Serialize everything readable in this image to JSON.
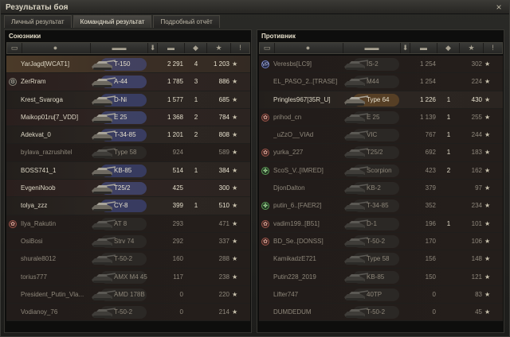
{
  "window": {
    "title": "Результаты боя",
    "close_label": "×"
  },
  "tabs": [
    {
      "label": "Личный результат",
      "active": false
    },
    {
      "label": "Командный результат",
      "active": true
    },
    {
      "label": "Подробный отчёт",
      "active": false
    }
  ],
  "header_icons": [
    "squad-icon",
    "player-icon",
    "tank-icon",
    "sort-arrow-icon",
    "damage-icon",
    "kills-icon",
    "xp-star-icon",
    "info-icon"
  ],
  "allies": {
    "title": "Союзники",
    "rows": [
      {
        "name": "YarJagd[WCAT1]",
        "badge": "",
        "tank": "T-150",
        "damage": "2 291",
        "kills": "4",
        "xp": "1 203",
        "state": "mine",
        "color": "#4d5fbf"
      },
      {
        "name": "ZerRram",
        "badge": "gear",
        "tank": "A-44",
        "damage": "1 785",
        "kills": "3",
        "xp": "886",
        "state": "alive",
        "color": "#5a6fd0"
      },
      {
        "name": "Krest_Svaroga",
        "badge": "",
        "tank": "D-Ni",
        "damage": "1 577",
        "kills": "1",
        "xp": "685",
        "state": "alive",
        "color": "#4f63c8"
      },
      {
        "name": "Maikop01ru[7_VDD]",
        "badge": "",
        "tank": "E 25",
        "damage": "1 368",
        "kills": "2",
        "xp": "784",
        "state": "alive",
        "color": "#5670cf"
      },
      {
        "name": "Adekvat_0",
        "badge": "",
        "tank": "T-34-85",
        "damage": "1 201",
        "kills": "2",
        "xp": "808",
        "state": "alive",
        "color": "#4e62c4"
      },
      {
        "name": "bylava_razrushitel",
        "badge": "",
        "tank": "Type 58",
        "damage": "924",
        "kills": "",
        "xp": "589",
        "state": "dead",
        "color": "#3b3a36"
      },
      {
        "name": "BOSS741_1",
        "badge": "",
        "tank": "KB-85",
        "damage": "514",
        "kills": "1",
        "xp": "384",
        "state": "alive",
        "color": "#4a5fc3"
      },
      {
        "name": "EvgeniNoob",
        "badge": "",
        "tank": "T25/2",
        "damage": "425",
        "kills": "",
        "xp": "300",
        "state": "alive",
        "color": "#5b70d2"
      },
      {
        "name": "tolya_zzz",
        "badge": "",
        "tank": "CY-8",
        "damage": "399",
        "kills": "1",
        "xp": "510",
        "state": "alive",
        "color": "#4b5fc5"
      },
      {
        "name": "Ilya_Rakutin",
        "badge": "flower",
        "tank": "AT 8",
        "damage": "293",
        "kills": "",
        "xp": "471",
        "state": "dead",
        "color": "#3b3a36"
      },
      {
        "name": "OsiBosi",
        "badge": "",
        "tank": "Strv 74",
        "damage": "292",
        "kills": "",
        "xp": "337",
        "state": "dead",
        "color": "#3b3a36"
      },
      {
        "name": "shurale8012",
        "badge": "",
        "tank": "T-50-2",
        "damage": "160",
        "kills": "",
        "xp": "288",
        "state": "dead",
        "color": "#3b3a36"
      },
      {
        "name": "torius777",
        "badge": "",
        "tank": "AMX M4 45",
        "damage": "117",
        "kills": "",
        "xp": "238",
        "state": "dead",
        "color": "#3b3a36"
      },
      {
        "name": "President_Putin_Vla...",
        "badge": "",
        "tank": "AMD 178B",
        "damage": "0",
        "kills": "",
        "xp": "220",
        "state": "dead",
        "color": "#3b3a36"
      },
      {
        "name": "Vodianoy_76",
        "badge": "",
        "tank": "T-50-2",
        "damage": "0",
        "kills": "",
        "xp": "214",
        "state": "dead",
        "color": "#3b3a36"
      }
    ]
  },
  "enemies": {
    "title": "Противник",
    "rows": [
      {
        "name": "Veresbs[LC9]",
        "badge": "vip",
        "tank": "IS-2",
        "damage": "1 254",
        "kills": "",
        "xp": "302",
        "state": "dead",
        "color": "#3b3a36"
      },
      {
        "name": "EL_PASO_2..[TRASE]",
        "badge": "",
        "tank": "M44",
        "damage": "1 254",
        "kills": "",
        "xp": "224",
        "state": "dead",
        "color": "#3b3a36"
      },
      {
        "name": "Pringles967[35R_U]",
        "badge": "",
        "tank": "Type 64",
        "damage": "1 226",
        "kills": "1",
        "xp": "430",
        "state": "alive",
        "color": "#9a6a2a"
      },
      {
        "name": "prihod_cn",
        "badge": "flower",
        "tank": "E 25",
        "damage": "1 139",
        "kills": "1",
        "xp": "255",
        "state": "dead",
        "color": "#3b3a36"
      },
      {
        "name": "_uZzO__VIAd",
        "badge": "",
        "tank": "VIC",
        "damage": "767",
        "kills": "1",
        "xp": "244",
        "state": "dead",
        "color": "#3b3a36"
      },
      {
        "name": "yurka_227",
        "badge": "flower",
        "tank": "T25/2",
        "damage": "692",
        "kills": "1",
        "xp": "183",
        "state": "dead",
        "color": "#3b3a36"
      },
      {
        "name": "ScoS_V..[IMRED]",
        "badge": "leaf",
        "tank": "Scorpion",
        "damage": "423",
        "kills": "2",
        "xp": "162",
        "state": "dead",
        "color": "#3b3a36"
      },
      {
        "name": "DjonDalton",
        "badge": "",
        "tank": "KB-2",
        "damage": "379",
        "kills": "",
        "xp": "97",
        "state": "dead",
        "color": "#3b3a36"
      },
      {
        "name": "putin_6..[FAER2]",
        "badge": "leaf",
        "tank": "T-34-85",
        "damage": "352",
        "kills": "",
        "xp": "234",
        "state": "dead",
        "color": "#3b3a36"
      },
      {
        "name": "vadim199..[B51]",
        "badge": "flower",
        "tank": "D-1",
        "damage": "196",
        "kills": "1",
        "xp": "101",
        "state": "dead",
        "color": "#3b3a36"
      },
      {
        "name": "BD_Se..[DONSS]",
        "badge": "flower",
        "tank": "T-50-2",
        "damage": "170",
        "kills": "",
        "xp": "106",
        "state": "dead",
        "color": "#3b3a36"
      },
      {
        "name": "KamikadzE721",
        "badge": "",
        "tank": "Type 58",
        "damage": "156",
        "kills": "",
        "xp": "148",
        "state": "dead",
        "color": "#3b3a36"
      },
      {
        "name": "Putin228_2019",
        "badge": "",
        "tank": "KB-85",
        "damage": "150",
        "kills": "",
        "xp": "121",
        "state": "dead",
        "color": "#3b3a36"
      },
      {
        "name": "Lifter747",
        "badge": "",
        "tank": "40TP",
        "damage": "0",
        "kills": "",
        "xp": "83",
        "state": "dead",
        "color": "#3b3a36"
      },
      {
        "name": "DUMDEDUM",
        "badge": "",
        "tank": "T-50-2",
        "damage": "0",
        "kills": "",
        "xp": "45",
        "state": "dead",
        "color": "#3b3a36"
      }
    ]
  },
  "star_glyph": "★"
}
